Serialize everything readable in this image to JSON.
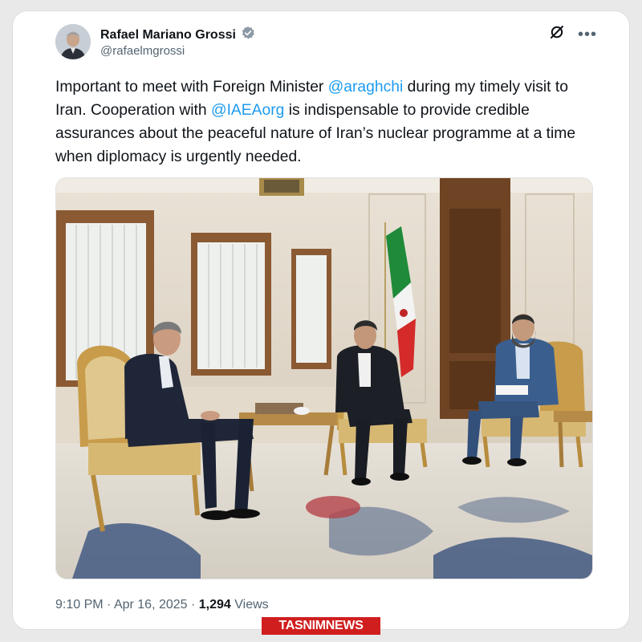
{
  "tweet": {
    "author": {
      "display_name": "Rafael Mariano Grossi",
      "handle": "@rafaelmgrossi",
      "verified": true
    },
    "text_parts": {
      "p1": "Important to meet with Foreign Minister ",
      "mention1": "@araghchi",
      "p2": " during my timely visit to Iran. Cooperation with ",
      "mention2": "@IAEAorg",
      "p3": " is indispensable to provide credible assurances about the peaceful nature of Iran’s nuclear programme at a time when diplomacy is urgently needed."
    },
    "meta": {
      "time": "9:10 PM",
      "separator": " · ",
      "date": "Apr 16, 2025",
      "views_count": "1,294",
      "views_label": " Views"
    }
  },
  "icons": {
    "verified": "verified-badge-icon",
    "grok": "grok-icon",
    "more": "more-icon"
  },
  "colors": {
    "link": "#1d9bf0",
    "secondary_text": "#536471",
    "watermark_bg": "#d01e1e"
  },
  "watermark": {
    "text": "TASNIMNEWS"
  }
}
